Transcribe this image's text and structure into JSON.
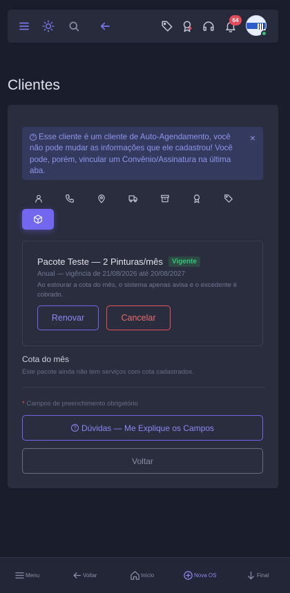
{
  "header": {
    "icons": [
      "menu-icon",
      "sun-icon",
      "search-icon",
      "arrow-left-icon",
      "tag-icon",
      "award-icon",
      "headphones-icon",
      "bell-icon"
    ],
    "notification_count": "64",
    "avatar_status": "online"
  },
  "page_title": "Clientes",
  "alert": {
    "text": "Esse cliente é um cliente de Auto-Agendamento, você não pode mudar as informações que ele cadastrou! Você pode, porém, vincular um Convênio/Assinatura na última aba.",
    "close": "×"
  },
  "tabs": {
    "items": [
      "user-icon",
      "phone-icon",
      "map-pin-icon",
      "truck-icon",
      "archive-icon",
      "award-icon",
      "tag-icon",
      "package-icon"
    ],
    "active": "package-icon"
  },
  "package": {
    "title": "Pacote Teste — 2 Pinturas/mês",
    "badge": "Vigente",
    "subtitle": "Anual — vigência de 21/08/2026 até 20/08/2027",
    "note": "Ao estourar a cota do mês, o sistema apenas avisa e o excedente é cobrado.",
    "renew_label": "Renovar",
    "cancel_label": "Cancelar"
  },
  "quota": {
    "title": "Cota do mês",
    "note": "Este pacote ainda não tem serviços com cota cadastrados."
  },
  "form": {
    "required_star": "*",
    "required_note": "Campos de preenchimento obrigatório",
    "help_label": "Dúvidas — Me Explique os Campos",
    "back_label": "Voltar"
  },
  "bottom_nav": {
    "menu": "Menu",
    "back": "Voltar",
    "home": "Início",
    "new_os": "Nova OS",
    "end": "Final"
  },
  "colors": {
    "accent": "#7367f0",
    "danger": "#ea5455",
    "success": "#36c37a",
    "background": "#1a1d2c",
    "card": "#2a2d3e"
  }
}
